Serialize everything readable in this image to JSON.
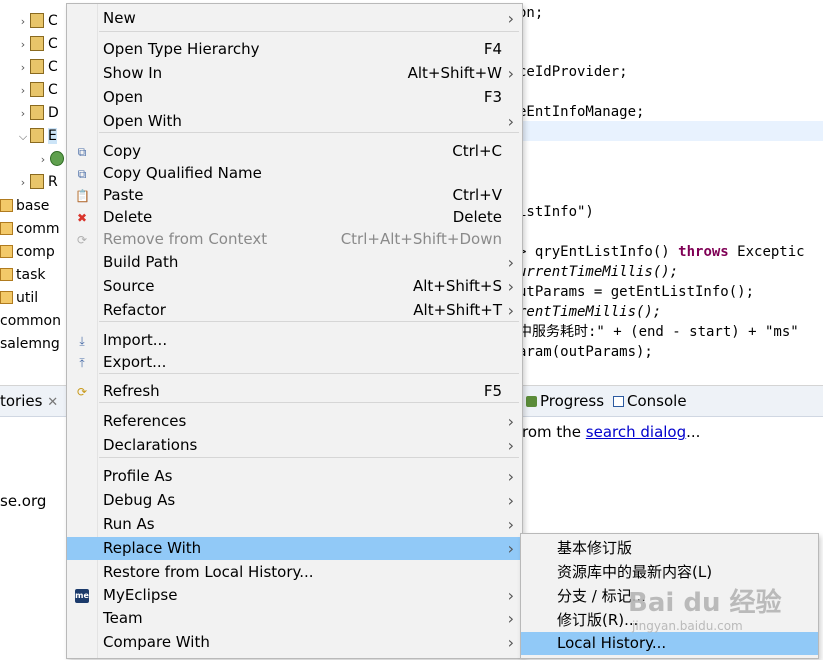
{
  "tree": {
    "top_items": [
      {
        "label": "C",
        "chev": ">"
      },
      {
        "label": "C",
        "chev": ">"
      },
      {
        "label": "C",
        "chev": ">"
      },
      {
        "label": "C",
        "chev": ">"
      },
      {
        "label": "D",
        "chev": ">"
      },
      {
        "label": "E",
        "chev": "v"
      },
      {
        "label": "",
        "chev": ">"
      },
      {
        "label": "R",
        "chev": ">"
      }
    ],
    "packages": [
      "base",
      "comm",
      "comp",
      "task",
      "util"
    ],
    "modules": [
      "common",
      "salemng"
    ]
  },
  "code_lines": [
    {
      "text": "on;"
    },
    {
      "text": "ceIdProvider;"
    },
    {
      "text": "eEntInfoManage;"
    },
    {
      "text": "istInfo\")"
    },
    {
      "text": "> qryEntListInfo() ",
      "kw": "throws",
      "rest": " Exceptic"
    },
    {
      "text": "urrentTimeMillis();"
    },
    {
      "text": "utParams = getEntListInfo();"
    },
    {
      "text": "rentTimeMillis();"
    },
    {
      "text": "中服务耗时:\" + (end - start) + \"ms\""
    },
    {
      "text": "aram(outParams);"
    }
  ],
  "bottom": {
    "left_tab": "tories",
    "left_text": "se.org",
    "tab_progress": "Progress",
    "tab_console": "Console",
    "hint_prefix": "rom the ",
    "hint_link": "search dialog",
    "hint_suffix": "..."
  },
  "menu": {
    "items": [
      {
        "label": "New",
        "accel": "",
        "submenu": true
      },
      {
        "label": "Open Type Hierarchy",
        "accel": "F4"
      },
      {
        "label": "Show In",
        "accel": "Alt+Shift+W",
        "submenu": true
      },
      {
        "label": "Open",
        "accel": "F3"
      },
      {
        "label": "Open With",
        "accel": "",
        "submenu": true
      },
      {
        "label": "Copy",
        "accel": "Ctrl+C",
        "icon": "copy-icon"
      },
      {
        "label": "Copy Qualified Name",
        "accel": "",
        "icon": "copy-qualified-icon"
      },
      {
        "label": "Paste",
        "accel": "Ctrl+V",
        "icon": "paste-icon"
      },
      {
        "label": "Delete",
        "accel": "Delete",
        "icon": "delete-icon"
      },
      {
        "label": "Remove from Context",
        "accel": "Ctrl+Alt+Shift+Down",
        "disabled": true,
        "icon": "remove-context-icon"
      },
      {
        "label": "Build Path",
        "accel": "",
        "submenu": true
      },
      {
        "label": "Source",
        "accel": "Alt+Shift+S",
        "submenu": true
      },
      {
        "label": "Refactor",
        "accel": "Alt+Shift+T",
        "submenu": true
      },
      {
        "label": "Import...",
        "accel": "",
        "icon": "import-icon"
      },
      {
        "label": "Export...",
        "accel": "",
        "icon": "export-icon"
      },
      {
        "label": "Refresh",
        "accel": "F5",
        "icon": "refresh-icon"
      },
      {
        "label": "References",
        "accel": "",
        "submenu": true
      },
      {
        "label": "Declarations",
        "accel": "",
        "submenu": true
      },
      {
        "label": "Profile As",
        "accel": "",
        "submenu": true
      },
      {
        "label": "Debug As",
        "accel": "",
        "submenu": true
      },
      {
        "label": "Run As",
        "accel": "",
        "submenu": true
      },
      {
        "label": "Replace With",
        "accel": "",
        "submenu": true,
        "highlighted": true
      },
      {
        "label": "Restore from Local History...",
        "accel": ""
      },
      {
        "label": "MyEclipse",
        "accel": "",
        "submenu": true,
        "icon": "myeclipse-icon"
      },
      {
        "label": "Team",
        "accel": "",
        "submenu": true
      },
      {
        "label": "Compare With",
        "accel": "",
        "submenu": true
      }
    ],
    "myeclipse_badge": "me"
  },
  "submenu": {
    "items": [
      {
        "label": "基本修订版"
      },
      {
        "label": "资源库中的最新内容(L)"
      },
      {
        "label": "分支 / 标记..."
      },
      {
        "label": "修订版(R)..."
      },
      {
        "label": "Local History...",
        "highlighted": true
      }
    ]
  },
  "watermark": {
    "brand": "Bai du 经验",
    "url": "jingyan.baidu.com"
  },
  "colors": {
    "highlight": "#91c9f7",
    "menu_bg": "#f2f2f2",
    "keyword": "#7f0055",
    "string": "#2a00ff",
    "link": "#0000cc"
  }
}
